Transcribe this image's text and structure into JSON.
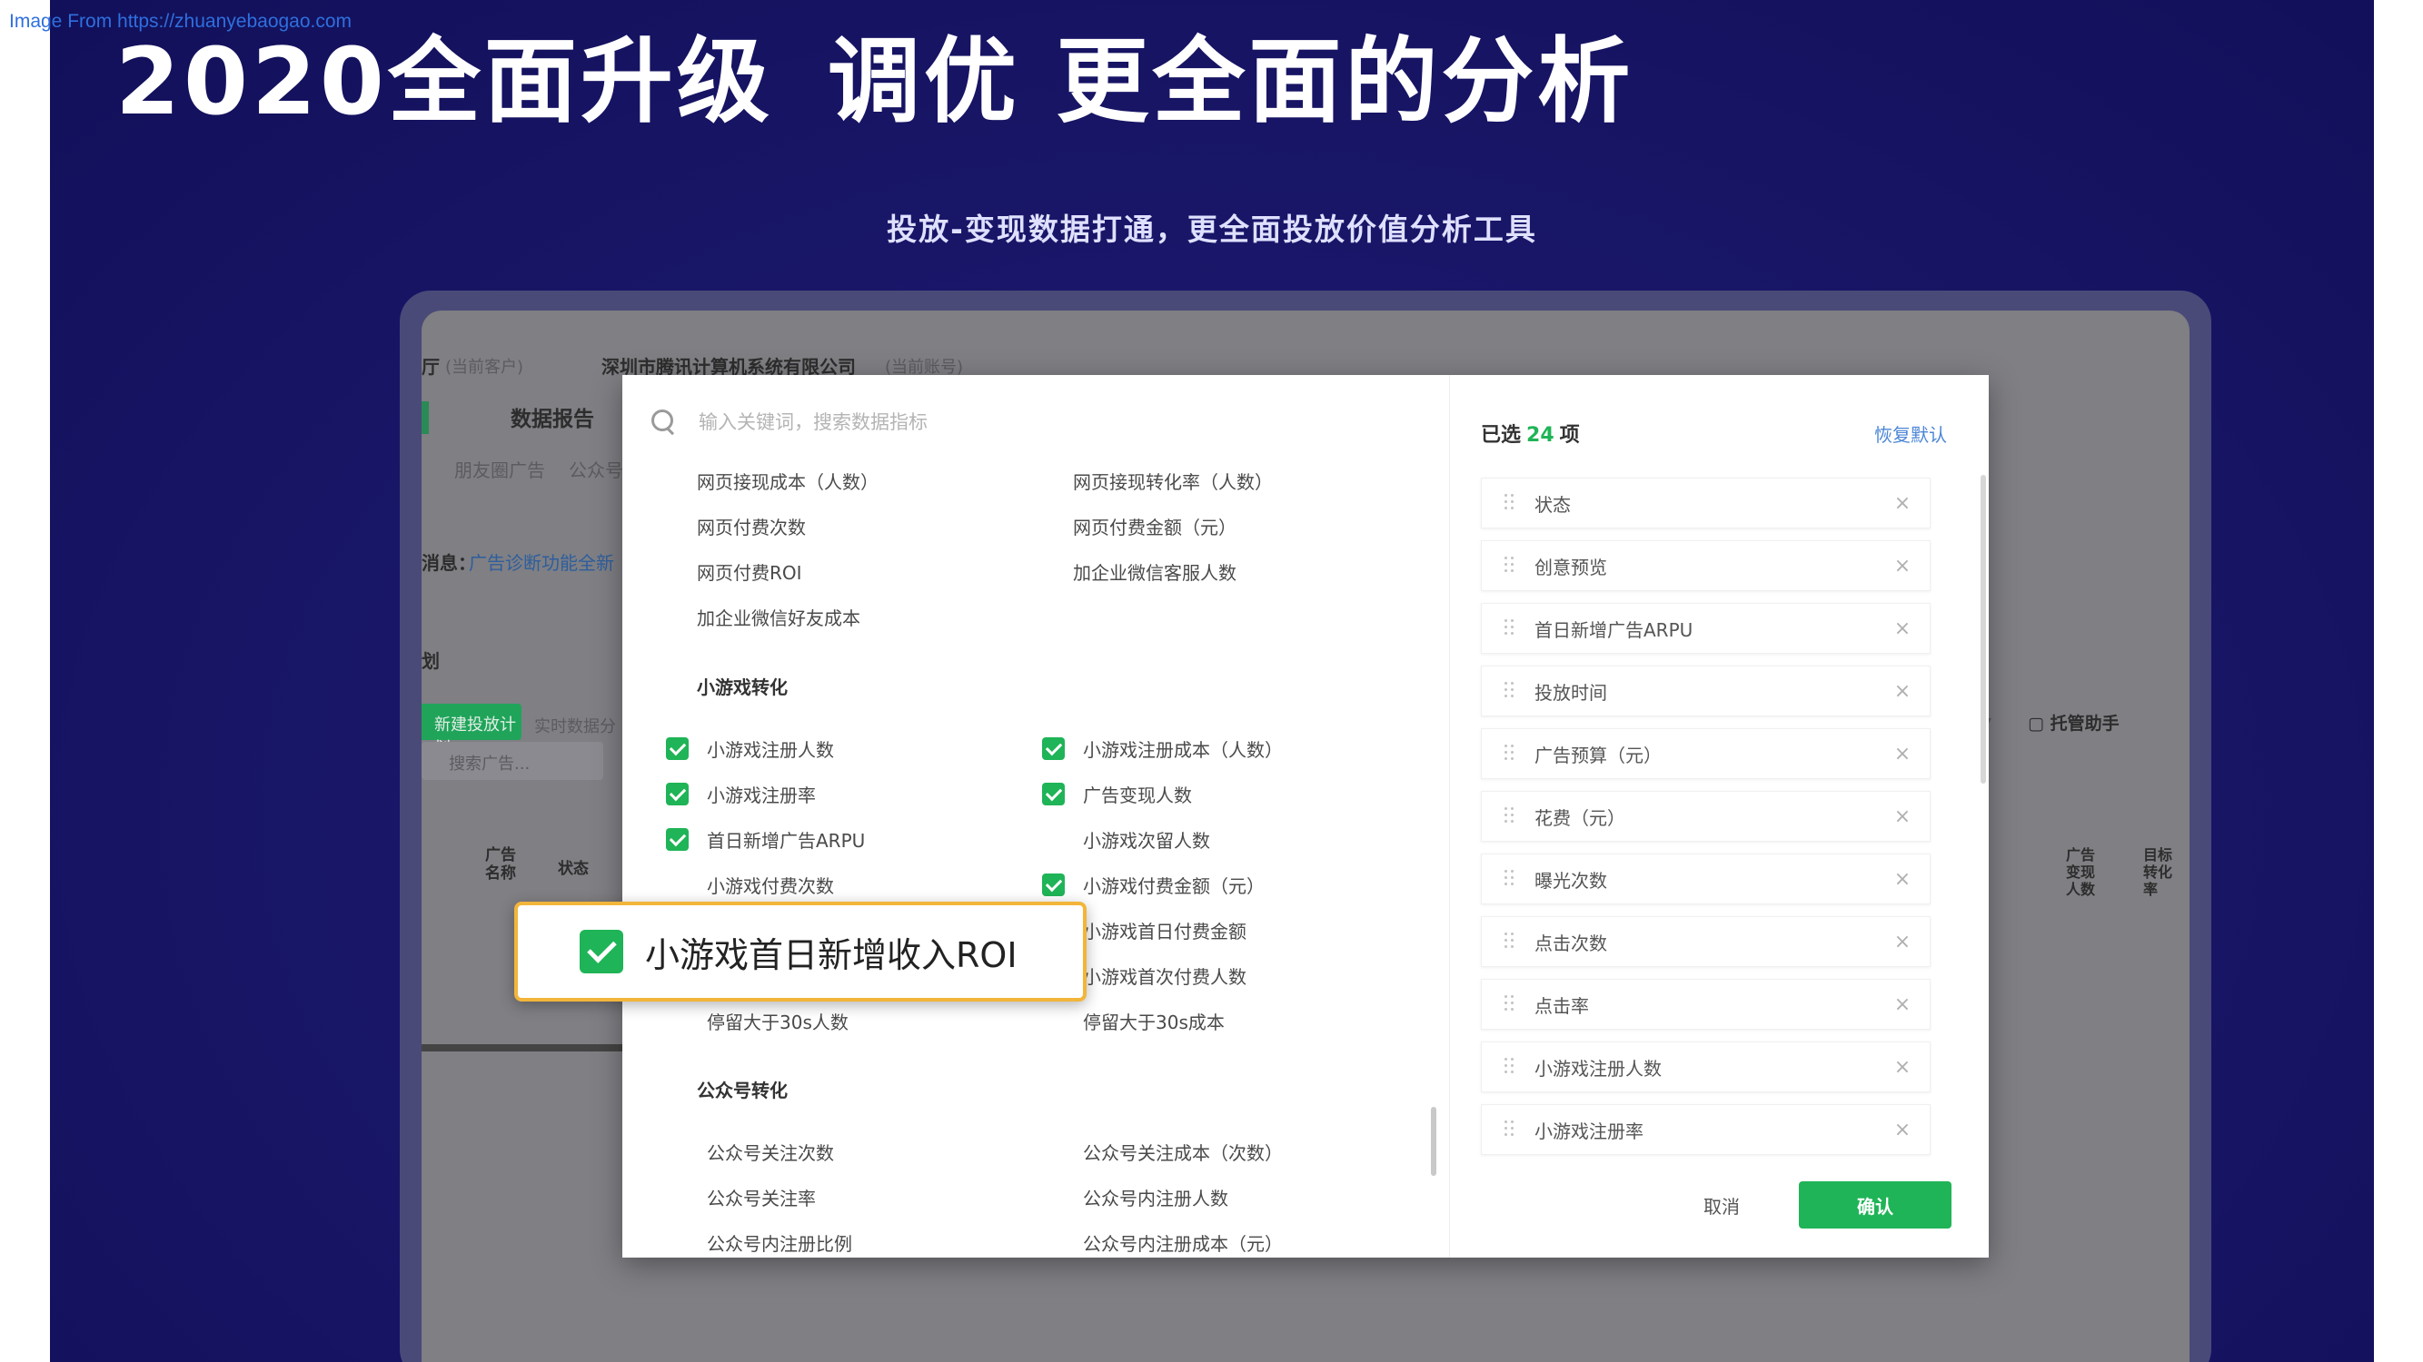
{
  "watermark": "Image From https://zhuanyebaogao.com",
  "hero": {
    "title_part1": "2020全面升级",
    "title_part2": "调优 更全面的分析",
    "subtitle": "投放-变现数据打通，更全面投放价值分析工具"
  },
  "background_app": {
    "header_partial": "厅",
    "header_current": "(当前客户)",
    "company": "深圳市腾讯计算机系统有限公司",
    "company_tag": "(当前账号)",
    "nav_data_report": "数据报告",
    "tab_moments": "朋友圈广告",
    "tab_official": "公众号",
    "notice_prefix": "消息：",
    "notice_text": "广告诊断功能全新",
    "section_label": "划",
    "new_plan_button": "新建投放计划",
    "realtime_data": "实时数据分",
    "search_placeholder": "搜索广告...",
    "col_ad_name": "广告\n名称",
    "col_status": "状态",
    "assistant": "托管助手",
    "col_ad_monetize": "广告\n变现\n人数",
    "col_target_conv": "目标\n转化\n率"
  },
  "modal": {
    "search_placeholder": "输入关键词，搜索数据指标",
    "left_items": [
      {
        "label": "网页接现成本（人数）",
        "checked": false
      },
      {
        "label": "网页接现转化率（人数）",
        "checked": false
      },
      {
        "label": "网页付费次数",
        "checked": false
      },
      {
        "label": "网页付费金额（元）",
        "checked": false
      },
      {
        "label": "网页付费ROI",
        "checked": false
      },
      {
        "label": "加企业微信客服人数",
        "checked": false
      },
      {
        "label": "加企业微信好友成本",
        "checked": false
      }
    ],
    "section_minigame": "小游戏转化",
    "minigame_items": [
      {
        "label": "小游戏注册人数",
        "checked": true
      },
      {
        "label": "小游戏注册成本（人数）",
        "checked": true
      },
      {
        "label": "小游戏注册率",
        "checked": true
      },
      {
        "label": "广告变现人数",
        "checked": true
      },
      {
        "label": "首日新增广告ARPU",
        "checked": true
      },
      {
        "label": "小游戏次留人数",
        "checked": false
      },
      {
        "label": "小游戏付费次数",
        "checked": false
      },
      {
        "label": "小游戏付费金额（元）",
        "checked": true
      },
      {
        "label": "小游戏首日付费金额",
        "checked": false
      },
      {
        "label": "小游戏首次付费人数",
        "checked": false
      },
      {
        "label": "停留大于30s人数",
        "checked": false
      },
      {
        "label": "停留大于30s成本",
        "checked": false
      }
    ],
    "section_official": "公众号转化",
    "official_items": [
      {
        "label": "公众号关注次数",
        "checked": false
      },
      {
        "label": "公众号关注成本（次数）",
        "checked": false
      },
      {
        "label": "公众号关注率",
        "checked": false
      },
      {
        "label": "公众号内注册人数",
        "checked": false
      },
      {
        "label": "公众号内注册比例",
        "checked": false
      },
      {
        "label": "公众号内注册成本（元）",
        "checked": false
      }
    ],
    "selected_prefix": "已选",
    "selected_count": "24",
    "selected_suffix": "项",
    "restore_default": "恢复默认",
    "selected_items": [
      "状态",
      "创意预览",
      "首日新增广告ARPU",
      "投放时间",
      "广告预算（元）",
      "花费（元）",
      "曝光次数",
      "点击次数",
      "点击率",
      "小游戏注册人数",
      "小游戏注册率"
    ],
    "cancel": "取消",
    "confirm": "确认"
  },
  "callout": {
    "label": "小游戏首日新增收入ROI",
    "checked": true,
    "border_color": "#f2b53a"
  },
  "colors": {
    "accent_green": "#1fb457",
    "slide_bg": "#1a176a",
    "link_blue": "#4b86d6"
  }
}
